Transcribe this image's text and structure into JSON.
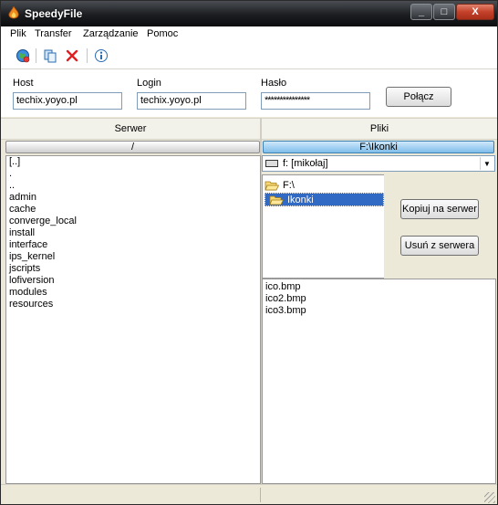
{
  "window": {
    "title": "SpeedyFile",
    "controls": [
      "_",
      "□",
      "X"
    ]
  },
  "menu": [
    "Plik",
    "Transfer",
    "Zarządzanie",
    "Pomoc"
  ],
  "toolbar": {
    "icons": [
      "globe-connect-icon",
      "copy-icon",
      "delete-icon",
      "info-icon"
    ]
  },
  "connection": {
    "host_label": "Host",
    "host_value": "techix.yoyo.pl",
    "login_label": "Login",
    "login_value": "techix.yoyo.pl",
    "password_label": "Hasło",
    "password_value": "***************",
    "connect_label": "Połącz"
  },
  "server": {
    "header": "Serwer",
    "path": "/",
    "items": [
      "[..]",
      ".",
      "..",
      "admin",
      "cache",
      "converge_local",
      "install",
      "interface",
      "ips_kernel",
      "jscripts",
      "lofiversion",
      "modules",
      "resources"
    ]
  },
  "files": {
    "header": "Pliki",
    "path": "F:\\Ikonki",
    "drive": "f: [mikołaj]",
    "tree": [
      "F:\\",
      "Ikonki"
    ],
    "items": [
      "ico.bmp",
      "ico2.bmp",
      "ico3.bmp"
    ],
    "copy_label": "Kopiuj na serwer",
    "delete_label": "Usuń z serwera"
  }
}
